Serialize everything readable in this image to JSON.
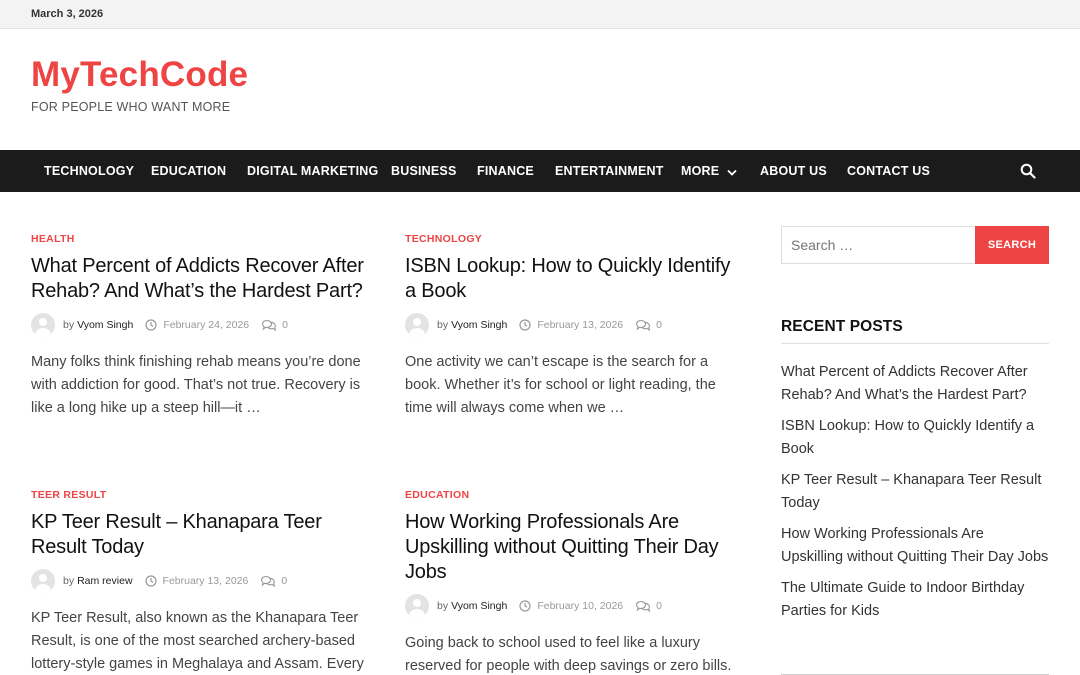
{
  "topbar": {
    "date": "March 3, 2026"
  },
  "site": {
    "title": "MyTechCode",
    "tagline": "FOR PEOPLE WHO WANT MORE"
  },
  "nav": {
    "items": [
      "TECHNOLOGY",
      "EDUCATION",
      "DIGITAL MARKETING",
      "BUSINESS",
      "FINANCE",
      "ENTERTAINMENT",
      "MORE",
      "ABOUT US",
      "CONTACT US"
    ]
  },
  "posts": [
    {
      "category": "HEALTH",
      "title": "What Percent of Addicts Recover After Rehab? And What’s the Hardest Part?",
      "by": "by",
      "author": "Vyom Singh",
      "date": "February 24, 2026",
      "comments": "0",
      "excerpt": "Many folks think finishing rehab means you’re done with addiction for good. That’s not true. Recovery is like a long hike up a steep hill—it …"
    },
    {
      "category": "TECHNOLOGY",
      "title": "ISBN Lookup: How to Quickly Identify a Book",
      "by": "by",
      "author": "Vyom Singh",
      "date": "February 13, 2026",
      "comments": "0",
      "excerpt": "One activity we can’t escape is the search for a book. Whether it’s for school or light reading, the time will always come when we …"
    },
    {
      "category": "TEER RESULT",
      "title": "KP Teer Result – Khanapara Teer Result Today",
      "by": "by",
      "author": "Ram review",
      "date": "February 13, 2026",
      "comments": "0",
      "excerpt": "KP Teer Result, also known as the Khanapara Teer Result, is one of the most searched archery-based lottery-style games in Meghalaya and Assam. Every"
    },
    {
      "category": "EDUCATION",
      "title": "How Working Professionals Are Upskilling without Quitting Their Day Jobs",
      "by": "by",
      "author": "Vyom Singh",
      "date": "February 10, 2026",
      "comments": "0",
      "excerpt": "Going back to school used to feel like a luxury reserved for people with deep savings or zero bills."
    }
  ],
  "sidebar": {
    "search": {
      "placeholder": "Search …",
      "button": "SEARCH"
    },
    "recent_title": "RECENT POSTS",
    "recent": [
      "What Percent of Addicts Recover After Rehab? And What’s the Hardest Part?",
      "ISBN Lookup: How to Quickly Identify a Book",
      "KP Teer Result – Khanapara Teer Result Today",
      "How Working Professionals Are Upskilling without Quitting Their Day Jobs",
      "The Ultimate Guide to Indoor Birthday Parties for Kids"
    ]
  },
  "colors": {
    "accent": "#ee4444",
    "nav_bg": "#1b1b1b",
    "topbar_bg": "#f3f3f3"
  }
}
